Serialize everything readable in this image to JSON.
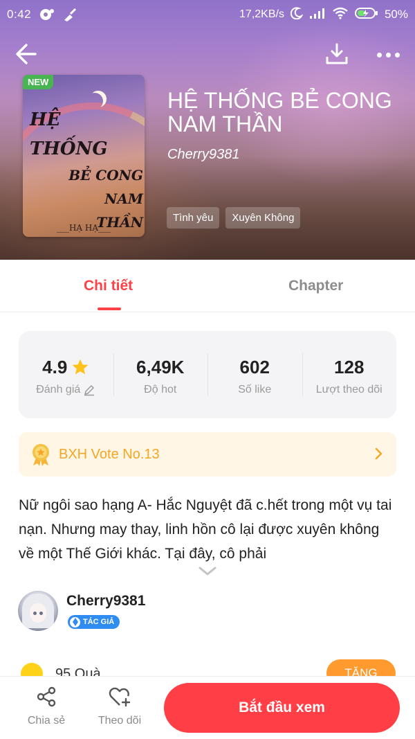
{
  "status_bar": {
    "time": "0:42",
    "network_speed": "17,2KB/s",
    "battery": "50%"
  },
  "book": {
    "title": "HỆ THỐNG BẺ CONG NAM THẦN",
    "author": "Cherry9381",
    "new_badge": "NEW",
    "cover_text_line1": "HỆ THỐNG",
    "cover_text_line2": "BẺ CONG NAM THẦN",
    "cover_author": "___HẠ HẠ___",
    "tags": [
      "Tình yêu",
      "Xuyên Không"
    ]
  },
  "tabs": {
    "detail": "Chi tiết",
    "chapter": "Chapter"
  },
  "stats": [
    {
      "value": "4.9",
      "label": "Đánh giá"
    },
    {
      "value": "6,49K",
      "label": "Độ hot"
    },
    {
      "value": "602",
      "label": "Số like"
    },
    {
      "value": "128",
      "label": "Lượt theo dõi"
    }
  ],
  "vote_banner": {
    "label": "BXH Vote No.13"
  },
  "description": "Nữ ngôi sao hạng A- Hắc Nguyệt đã c.hết trong một vụ tai nạn. Nhưng may thay, linh hồn cô lại được xuyên không về một Thế Giới khác. Tại đây, cô phải",
  "author_card": {
    "name": "Cherry9381",
    "badge": "TÁC GIẢ"
  },
  "gifts": {
    "text": "95 Quà",
    "button": "TẶNG"
  },
  "bottom_bar": {
    "share": "Chia sẻ",
    "follow": "Theo dõi",
    "start": "Bắt đầu xem"
  },
  "colors": {
    "accent": "#ff3f45",
    "vote": "#f5a623",
    "badge_new": "#48b552",
    "author_badge": "#2f8cf0"
  }
}
